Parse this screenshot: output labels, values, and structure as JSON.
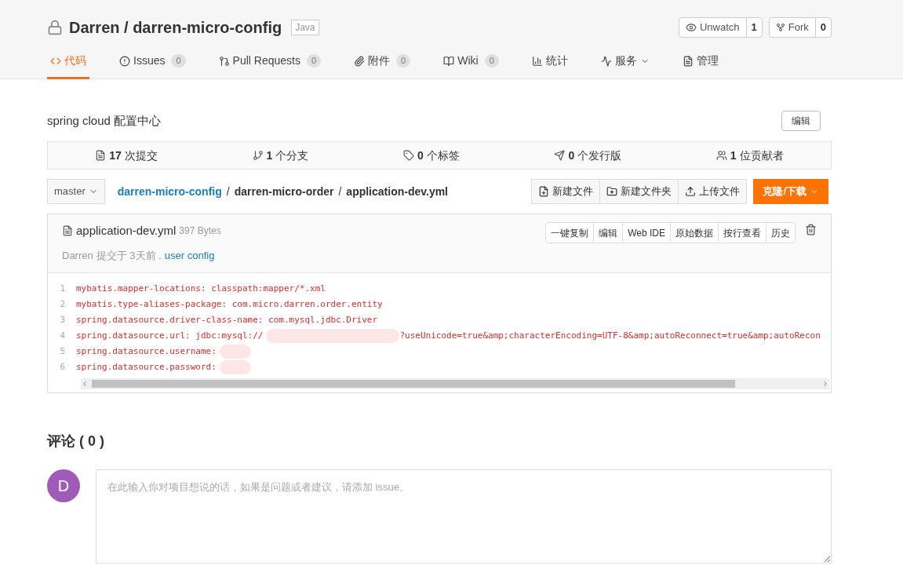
{
  "repo": {
    "title": "Darren / darren-micro-config",
    "language": "Java"
  },
  "actions": [
    {
      "label": "Unwatch",
      "count": "1"
    },
    {
      "label": "Fork",
      "count": "0"
    }
  ],
  "tabs": [
    {
      "label": "代码",
      "selected": true,
      "menu": false
    },
    {
      "label": "Issues",
      "count": "0",
      "selected": false,
      "menu": false
    },
    {
      "label": "Pull Requests",
      "count": "0",
      "selected": false,
      "menu": false
    },
    {
      "label": "附件",
      "count": "0",
      "selected": false,
      "menu": false
    },
    {
      "label": "Wiki",
      "count": "0",
      "selected": false,
      "menu": false
    },
    {
      "label": "统计",
      "selected": false,
      "menu": false
    },
    {
      "label": "服务",
      "selected": false,
      "menu": true
    },
    {
      "label": "管理",
      "selected": false,
      "menu": false
    }
  ],
  "description": "spring cloud 配置中心",
  "edit_button": "编辑",
  "stats": [
    {
      "count": "17",
      "label": "次提交"
    },
    {
      "count": "1",
      "label": "个分支"
    },
    {
      "count": "0",
      "label": "个标签"
    },
    {
      "count": "0",
      "label": "个发行版"
    },
    {
      "count": "1",
      "label": "位贡献者"
    }
  ],
  "branch": "master",
  "breadcrumb": {
    "separator": "/",
    "items": [
      "darren-micro-config",
      "darren-micro-order",
      "application-dev.yml"
    ]
  },
  "file_buttons": [
    "新建文件",
    "新建文件夹",
    "上传文件"
  ],
  "clone_button": "克隆/下载",
  "file": {
    "name": "application-dev.yml",
    "size": "397 Bytes",
    "author": "Darren",
    "committed": "提交于 3天前 .",
    "message": "user config",
    "tools": [
      "一键复制",
      "编辑",
      "Web IDE",
      "原始数据",
      "按行查看",
      "历史"
    ]
  },
  "code_lines": [
    {
      "number": "1",
      "text": "mybatis.mapper-locations: classpath:mapper/*.xml",
      "redacted": false
    },
    {
      "number": "2",
      "text": "mybatis.type-aliases-package: com.micro.darren.order.entity",
      "redacted": false
    },
    {
      "number": "3",
      "text": "spring.datasource.driver-class-name: com.mysql.jdbc.Driver",
      "redacted": false
    },
    {
      "number": "4",
      "text": "spring.datasource.url: jdbc:mysql://",
      "redacted": true,
      "after": "?useUnicode=true&amp;characterEncoding=UTF-8&amp;autoReconnect=true&amp;autoRecon"
    },
    {
      "number": "5",
      "text": "spring.datasource.username:",
      "redacted": true
    },
    {
      "number": "6",
      "text": "spring.datasource.password:",
      "redacted": true
    }
  ],
  "comments": {
    "title": "评论 ( 0 )",
    "avatar": "D",
    "placeholder": "在此输入你对项目想说的话，如果是问题或者建议，请添加 issue。"
  }
}
